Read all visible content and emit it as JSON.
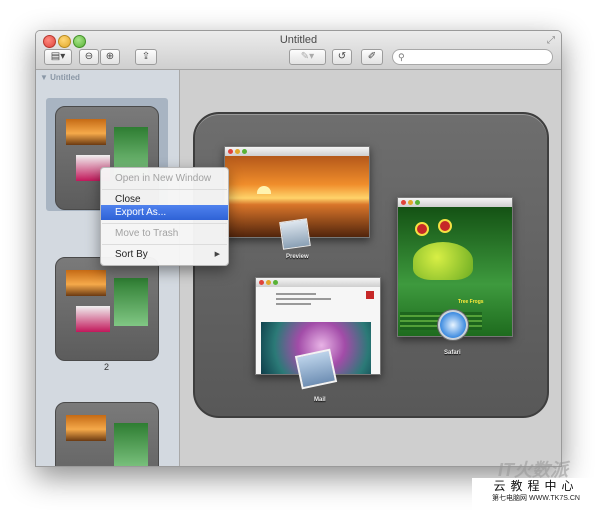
{
  "window": {
    "title": "Untitled"
  },
  "sidebar": {
    "header": "▼ Untitled",
    "page_label": "2"
  },
  "canvas": {
    "apps": [
      {
        "label": "Preview"
      },
      {
        "label": "Safari"
      },
      {
        "label": "Mail"
      }
    ],
    "frog_title": "Tree Frogs"
  },
  "context_menu": {
    "items": [
      {
        "label": "Open in New Window",
        "enabled": false
      },
      {
        "label": "Close",
        "enabled": true
      },
      {
        "label": "Export As...",
        "enabled": true,
        "highlighted": true
      },
      {
        "label": "Move to Trash",
        "enabled": false
      },
      {
        "label": "Sort By",
        "enabled": true,
        "submenu_arrow": "▶"
      }
    ]
  },
  "watermark": {
    "logo": "IT火数派",
    "line1": "云教程中心",
    "line2": "第七电脑网 WWW.TK7S.CN"
  },
  "icons": [
    "sidebar-toggle-icon",
    "zoom-out-icon",
    "zoom-in-icon",
    "share-icon",
    "pen-icon",
    "rotate-icon",
    "markup-icon",
    "search-icon",
    "fullscreen-icon"
  ]
}
